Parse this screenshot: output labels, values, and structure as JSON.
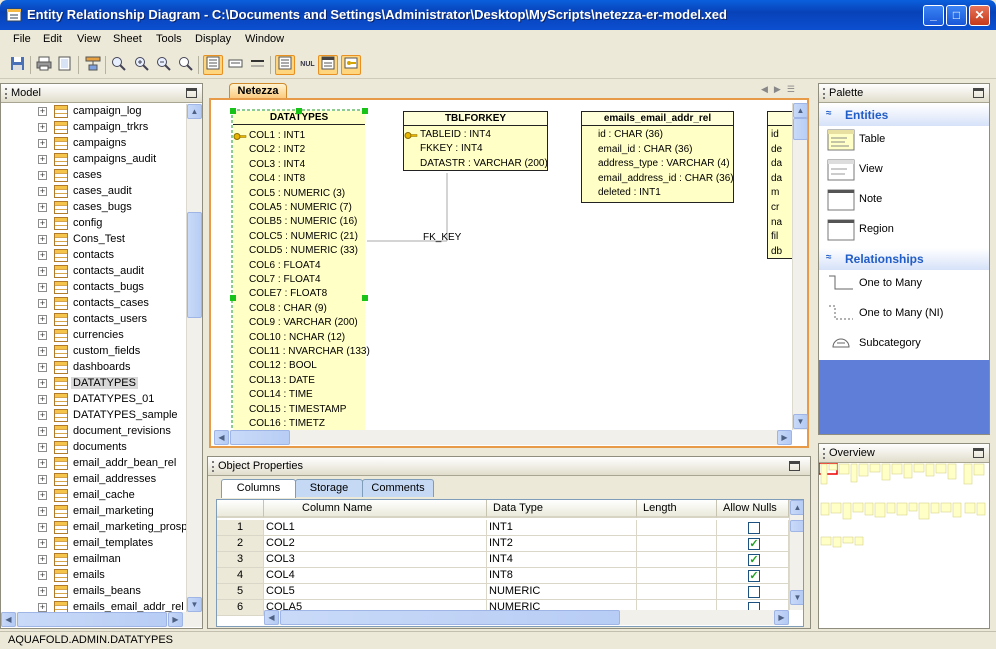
{
  "window": {
    "title": "Entity Relationship Diagram - C:\\Documents and Settings\\Administrator\\Desktop\\MyScripts\\netezza-er-model.xed"
  },
  "menu": [
    "File",
    "Edit",
    "View",
    "Sheet",
    "Tools",
    "Display",
    "Window"
  ],
  "toolbar_icons": [
    "save-icon",
    "print-icon",
    "page-setup-icon",
    "layout-icon",
    "zoom-fit-icon",
    "zoom-in-icon",
    "zoom-out-icon",
    "zoom-icon",
    "table-view-icon",
    "columns-icon",
    "lines-icon",
    "table-detail-icon",
    "null-icon",
    "entity-names-icon",
    "key-icon"
  ],
  "model": {
    "title": "Model",
    "selected": "DATATYPES",
    "items": [
      "campaign_log",
      "campaign_trkrs",
      "campaigns",
      "campaigns_audit",
      "cases",
      "cases_audit",
      "cases_bugs",
      "config",
      "Cons_Test",
      "contacts",
      "contacts_audit",
      "contacts_bugs",
      "contacts_cases",
      "contacts_users",
      "currencies",
      "custom_fields",
      "dashboards",
      "DATATYPES",
      "DATATYPES_01",
      "DATATYPES_sample",
      "document_revisions",
      "documents",
      "email_addr_bean_rel",
      "email_addresses",
      "email_cache",
      "email_marketing",
      "email_marketing_prosp",
      "email_templates",
      "emailman",
      "emails",
      "emails_beans",
      "emails_email_addr_rel"
    ]
  },
  "diagram": {
    "tab": "Netezza",
    "entities": [
      {
        "name": "DATATYPES",
        "rows": [
          "COL1 : INT1",
          "COL2 : INT2",
          "COL3 : INT4",
          "COL4 : INT8",
          "COL5 : NUMERIC (3)",
          "COLA5 : NUMERIC (7)",
          "COLB5 : NUMERIC (16)",
          "COLC5 : NUMERIC (21)",
          "COLD5 : NUMERIC (33)",
          "COL6 : FLOAT4",
          "COL7 : FLOAT4",
          "COLE7 : FLOAT8",
          "COL8 : CHAR (9)",
          "COL9 : VARCHAR (200)",
          "COL10 : NCHAR (12)",
          "COL11 : NVARCHAR (133)",
          "COL12 : BOOL",
          "COL13 : DATE",
          "COL14 : TIME",
          "COL15 : TIMESTAMP",
          "COL16 : TIMETZ"
        ]
      },
      {
        "name": "TBLFORKEY",
        "rows": [
          "TABLEID : INT4",
          "FKKEY : INT4",
          "DATASTR : VARCHAR (200)"
        ]
      },
      {
        "name": "emails_email_addr_rel",
        "rows": [
          "id : CHAR (36)",
          "email_id : CHAR (36)",
          "address_type : VARCHAR (4)",
          "email_address_id : CHAR (36)",
          "deleted : INT1"
        ]
      },
      {
        "name": "",
        "rows": [
          "id",
          "de",
          "da",
          "da",
          "m",
          "cr",
          "na",
          "fil",
          "db"
        ]
      }
    ],
    "relationship_label": "FK_KEY"
  },
  "object_properties": {
    "title": "Object Properties",
    "tabs": [
      "Columns",
      "Storage",
      "Comments"
    ],
    "active_tab": "Columns",
    "headers": [
      "Column Name",
      "Data Type",
      "Length",
      "Allow Nulls"
    ],
    "rows": [
      {
        "num": "1",
        "name": "COL1",
        "type": "INT1",
        "length": "",
        "nulls": false
      },
      {
        "num": "2",
        "name": "COL2",
        "type": "INT2",
        "length": "",
        "nulls": true
      },
      {
        "num": "3",
        "name": "COL3",
        "type": "INT4",
        "length": "",
        "nulls": true
      },
      {
        "num": "4",
        "name": "COL4",
        "type": "INT8",
        "length": "",
        "nulls": true
      },
      {
        "num": "5",
        "name": "COL5",
        "type": "NUMERIC",
        "length": "",
        "nulls": false
      },
      {
        "num": "6",
        "name": "COLA5",
        "type": "NUMERIC",
        "length": "",
        "nulls": false
      }
    ]
  },
  "palette": {
    "title": "Palette",
    "entities_title": "Entities",
    "entities": [
      "Table",
      "View",
      "Note",
      "Region"
    ],
    "relationships_title": "Relationships",
    "relationships": [
      "One to Many",
      "One to Many (NI)",
      "Subcategory"
    ]
  },
  "overview": {
    "title": "Overview"
  },
  "status": {
    "text": "AQUAFOLD.ADMIN.DATATYPES"
  },
  "colors": {
    "title_bar": "#0842b8",
    "accent_orange": "#e79a48",
    "entity_fill": "#ffffc6",
    "selection_handle": "#19c219",
    "palette_accent": "#215dc6"
  }
}
